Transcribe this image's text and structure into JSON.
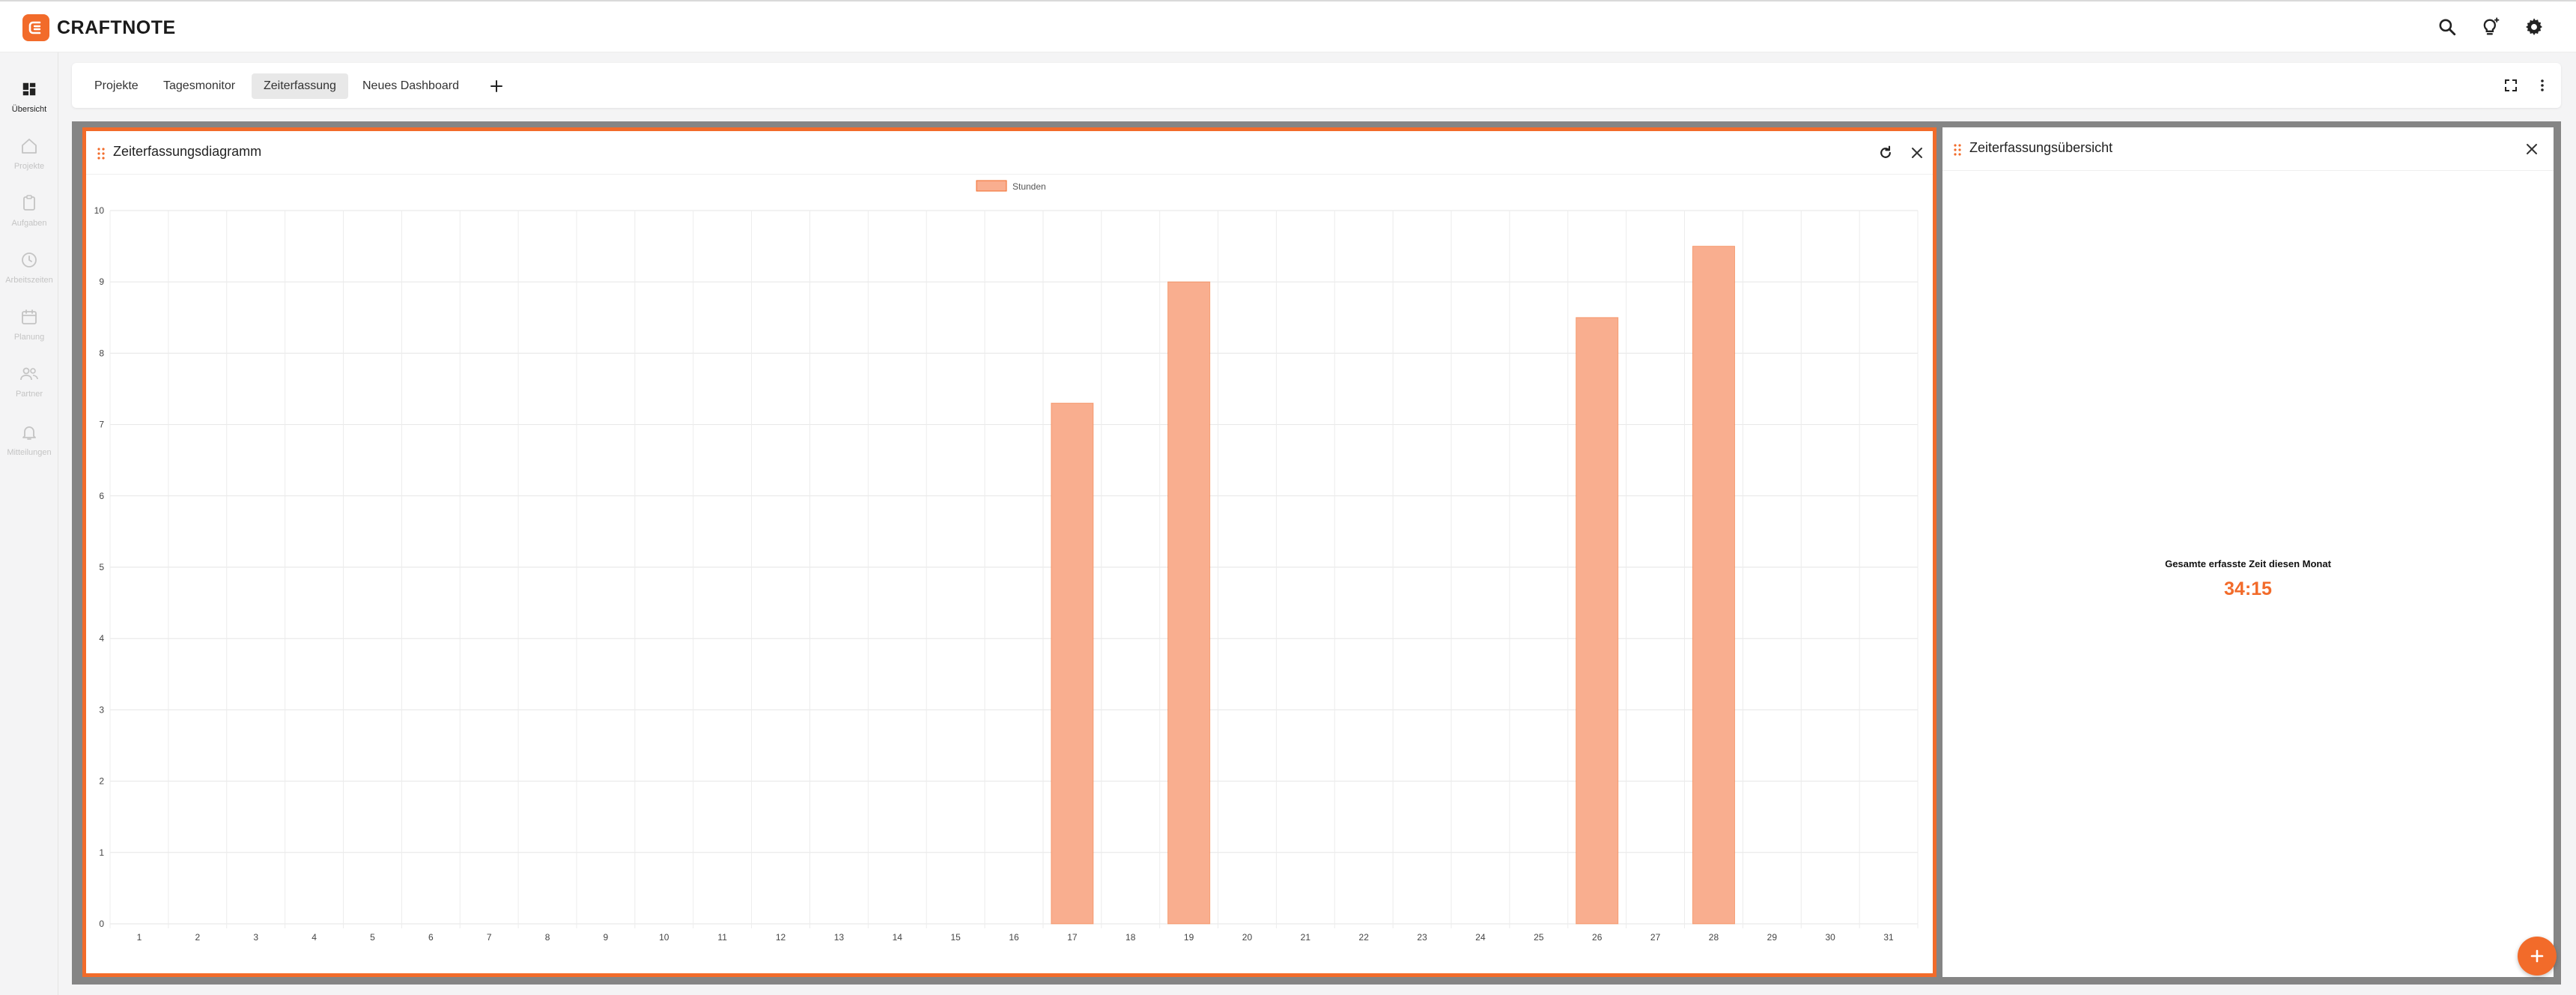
{
  "app": {
    "name": "CRAFTNOTE",
    "accent": "#f26b2a"
  },
  "header": {
    "icons": [
      "search-icon",
      "lightbulb-icon",
      "gear-icon"
    ]
  },
  "sidebar": {
    "items": [
      {
        "label": "Übersicht",
        "icon": "dashboard-icon",
        "active": true
      },
      {
        "label": "Projekte",
        "icon": "home-icon",
        "active": false
      },
      {
        "label": "Aufgaben",
        "icon": "clipboard-icon",
        "active": false
      },
      {
        "label": "Arbeitszeiten",
        "icon": "clock-icon",
        "active": false
      },
      {
        "label": "Planung",
        "icon": "calendar-icon",
        "active": false
      },
      {
        "label": "Partner",
        "icon": "people-icon",
        "active": false
      },
      {
        "label": "Mitteilungen",
        "icon": "bell-icon",
        "active": false
      }
    ]
  },
  "tabs": {
    "items": [
      {
        "label": "Projekte",
        "active": false
      },
      {
        "label": "Tagesmonitor",
        "active": false
      },
      {
        "label": "Zeiterfassung",
        "active": true
      },
      {
        "label": "Neues Dashboard",
        "active": false
      }
    ],
    "add_label": "+"
  },
  "widgets": {
    "chart_title": "Zeiterfassungsdiagramm",
    "overview_title": "Zeiterfassungsübersicht",
    "summary_label": "Gesamte erfasste Zeit diesen Monat",
    "summary_value": "34:15"
  },
  "chart_data": {
    "type": "bar",
    "categories": [
      "1",
      "2",
      "3",
      "4",
      "5",
      "6",
      "7",
      "8",
      "9",
      "10",
      "11",
      "12",
      "13",
      "14",
      "15",
      "16",
      "17",
      "18",
      "19",
      "20",
      "21",
      "22",
      "23",
      "24",
      "25",
      "26",
      "27",
      "28",
      "29",
      "30",
      "31"
    ],
    "series": [
      {
        "name": "Stunden",
        "color": "#f9ae8f",
        "border": "#f26b2a",
        "values": [
          0,
          0,
          0,
          0,
          0,
          0,
          0,
          0,
          0,
          0,
          0,
          0,
          0,
          0,
          0,
          0,
          7.3,
          0,
          9,
          0,
          0,
          0,
          0,
          0,
          0,
          8.5,
          0,
          9.5,
          0,
          0,
          0
        ]
      }
    ],
    "title": "",
    "xlabel": "",
    "ylabel": "",
    "ylim": [
      0,
      10
    ],
    "yticks": [
      "0",
      "1",
      "2",
      "3",
      "4",
      "5",
      "6",
      "7",
      "8",
      "9",
      "10"
    ],
    "grid": true,
    "legend": "top-center"
  }
}
